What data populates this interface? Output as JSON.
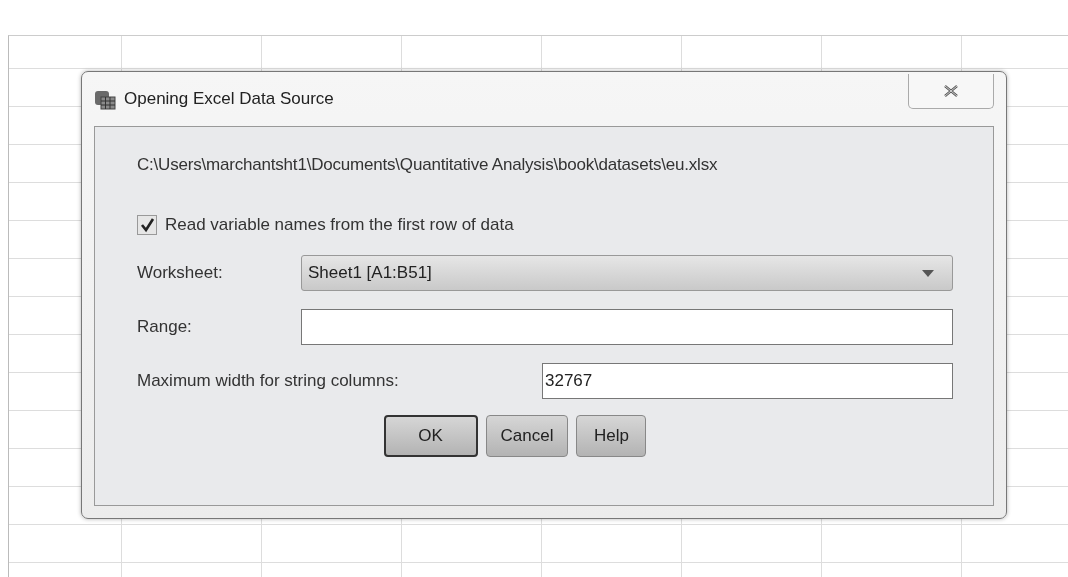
{
  "window": {
    "title": "Opening Excel Data Source"
  },
  "file_path": "C:\\Users\\marchantsht1\\Documents\\Quantitative Analysis\\book\\datasets\\eu.xlsx",
  "read_names": {
    "label": "Read variable names from the first row of data",
    "checked": true
  },
  "worksheet": {
    "label": "Worksheet:",
    "value": "Sheet1 [A1:B51]"
  },
  "range": {
    "label": "Range:"
  },
  "max_width": {
    "label": "Maximum width for string columns:",
    "value": "32767"
  },
  "buttons": [
    {
      "label": "OK",
      "default": true
    },
    {
      "label": "Cancel",
      "default": false
    },
    {
      "label": "Help",
      "default": false
    }
  ]
}
